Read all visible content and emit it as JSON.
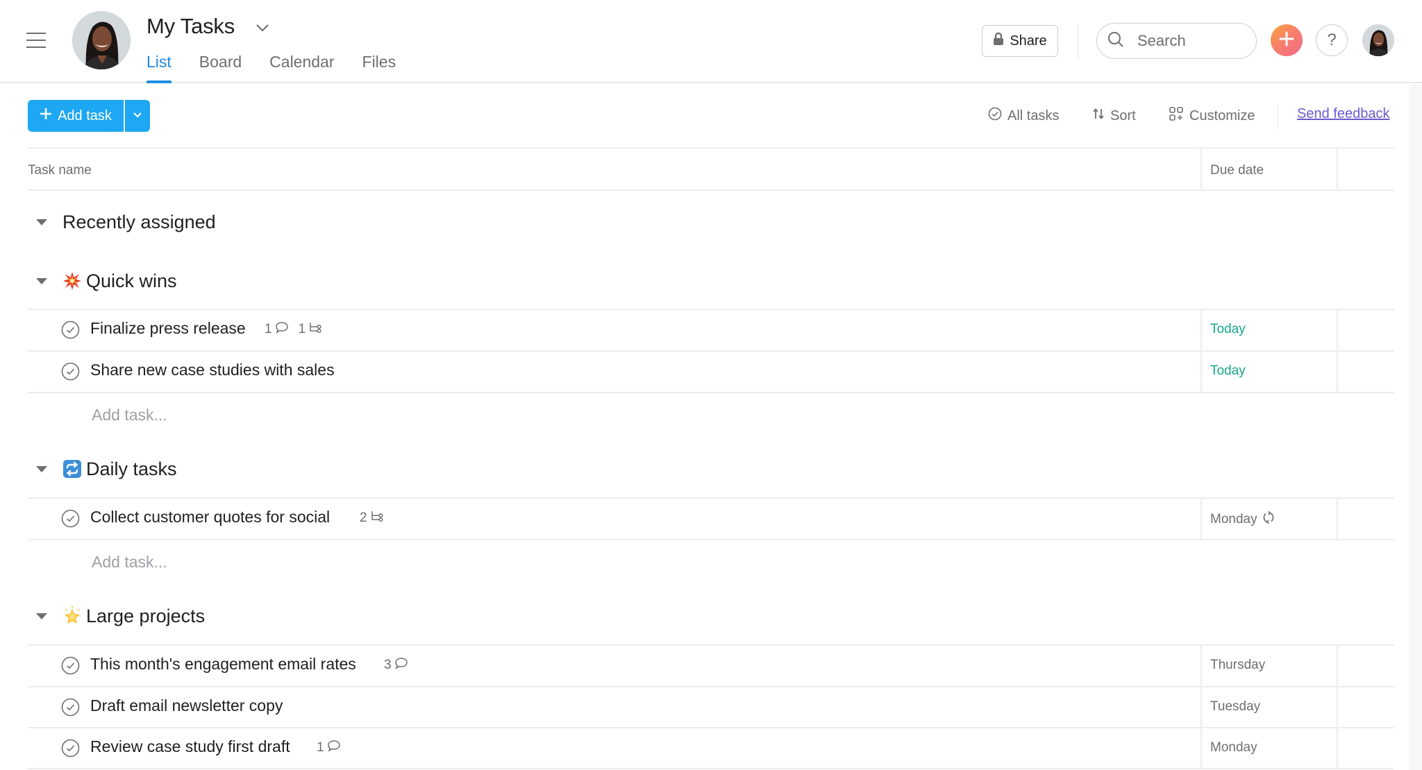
{
  "header": {
    "title": "My Tasks",
    "tabs": [
      {
        "label": "List",
        "active": true
      },
      {
        "label": "Board",
        "active": false
      },
      {
        "label": "Calendar",
        "active": false
      },
      {
        "label": "Files",
        "active": false
      }
    ],
    "share_label": "Share",
    "search_placeholder": "Search",
    "help_label": "?",
    "icons": {
      "menu": "hamburger-icon",
      "title_dropdown": "chevron-down-icon",
      "share": "lock-icon",
      "search": "search-icon",
      "quick_add": "plus-icon",
      "help": "question-icon"
    }
  },
  "toolbar": {
    "add_task_label": "Add task",
    "all_tasks_label": "All tasks",
    "sort_label": "Sort",
    "customize_label": "Customize",
    "feedback_label": "Send feedback"
  },
  "table": {
    "columns": [
      "Task name",
      "Due date",
      ""
    ],
    "add_task_placeholder": "Add task...",
    "sections": [
      {
        "title": "Recently assigned",
        "emoji": "",
        "tasks": []
      },
      {
        "title": "Quick wins",
        "emoji": "collision",
        "tasks": [
          {
            "name": "Finalize press release",
            "comments": "1",
            "subtasks": "1",
            "due": "Today",
            "due_status": "today"
          },
          {
            "name": "Share new case studies with sales",
            "comments": "",
            "subtasks": "",
            "due": "Today",
            "due_status": "today"
          }
        ]
      },
      {
        "title": "Daily tasks",
        "emoji": "repeat",
        "tasks": [
          {
            "name": "Collect customer quotes for social",
            "comments": "",
            "subtasks": "2",
            "due": "Monday",
            "due_status": "normal",
            "recurring": true
          }
        ]
      },
      {
        "title": "Large projects",
        "emoji": "glowing-star",
        "tasks": [
          {
            "name": "This month's engagement email rates",
            "comments": "3",
            "subtasks": "",
            "due": "Thursday",
            "due_status": "normal"
          },
          {
            "name": "Draft email newsletter copy",
            "comments": "",
            "subtasks": "",
            "due": "Tuesday",
            "due_status": "normal"
          },
          {
            "name": "Review case study first draft",
            "comments": "1",
            "subtasks": "",
            "due": "Monday",
            "due_status": "normal"
          }
        ]
      }
    ]
  },
  "colors": {
    "accent_blue": "#1ea7f2",
    "tab_active": "#1f8ce0",
    "today_green": "#14a889",
    "feedback_link": "#6a5acd",
    "quick_add_gradient": [
      "#f9a63a",
      "#f06a8a"
    ]
  }
}
